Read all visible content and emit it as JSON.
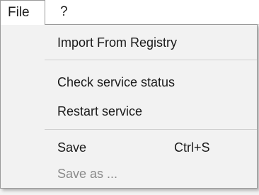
{
  "menubar": {
    "file_label": "File",
    "help_label": "?"
  },
  "file_menu": {
    "items": [
      {
        "label": "Import From Registry"
      },
      {
        "label": "Check service status"
      },
      {
        "label": "Restart service"
      },
      {
        "label": "Save",
        "shortcut": "Ctrl+S"
      },
      {
        "label": "Save as ...",
        "disabled": true
      }
    ]
  }
}
